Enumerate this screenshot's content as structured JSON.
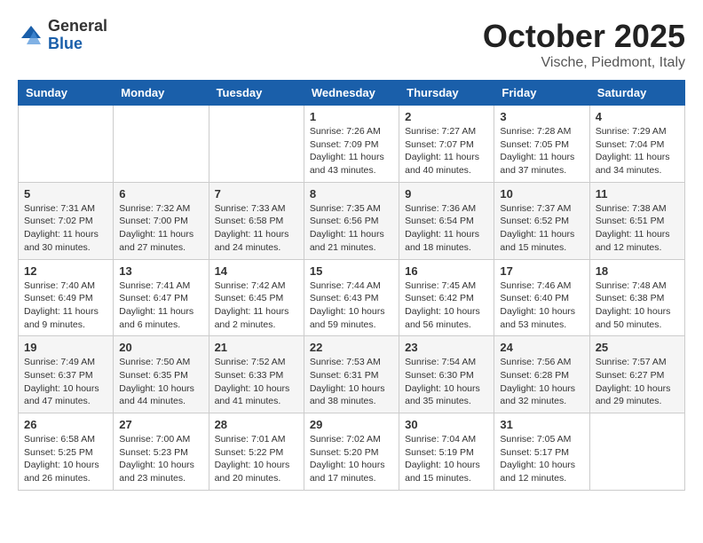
{
  "logo": {
    "general": "General",
    "blue": "Blue"
  },
  "title": "October 2025",
  "location": "Vische, Piedmont, Italy",
  "days_of_week": [
    "Sunday",
    "Monday",
    "Tuesday",
    "Wednesday",
    "Thursday",
    "Friday",
    "Saturday"
  ],
  "weeks": [
    [
      {
        "day": "",
        "info": ""
      },
      {
        "day": "",
        "info": ""
      },
      {
        "day": "",
        "info": ""
      },
      {
        "day": "1",
        "info": "Sunrise: 7:26 AM\nSunset: 7:09 PM\nDaylight: 11 hours\nand 43 minutes."
      },
      {
        "day": "2",
        "info": "Sunrise: 7:27 AM\nSunset: 7:07 PM\nDaylight: 11 hours\nand 40 minutes."
      },
      {
        "day": "3",
        "info": "Sunrise: 7:28 AM\nSunset: 7:05 PM\nDaylight: 11 hours\nand 37 minutes."
      },
      {
        "day": "4",
        "info": "Sunrise: 7:29 AM\nSunset: 7:04 PM\nDaylight: 11 hours\nand 34 minutes."
      }
    ],
    [
      {
        "day": "5",
        "info": "Sunrise: 7:31 AM\nSunset: 7:02 PM\nDaylight: 11 hours\nand 30 minutes."
      },
      {
        "day": "6",
        "info": "Sunrise: 7:32 AM\nSunset: 7:00 PM\nDaylight: 11 hours\nand 27 minutes."
      },
      {
        "day": "7",
        "info": "Sunrise: 7:33 AM\nSunset: 6:58 PM\nDaylight: 11 hours\nand 24 minutes."
      },
      {
        "day": "8",
        "info": "Sunrise: 7:35 AM\nSunset: 6:56 PM\nDaylight: 11 hours\nand 21 minutes."
      },
      {
        "day": "9",
        "info": "Sunrise: 7:36 AM\nSunset: 6:54 PM\nDaylight: 11 hours\nand 18 minutes."
      },
      {
        "day": "10",
        "info": "Sunrise: 7:37 AM\nSunset: 6:52 PM\nDaylight: 11 hours\nand 15 minutes."
      },
      {
        "day": "11",
        "info": "Sunrise: 7:38 AM\nSunset: 6:51 PM\nDaylight: 11 hours\nand 12 minutes."
      }
    ],
    [
      {
        "day": "12",
        "info": "Sunrise: 7:40 AM\nSunset: 6:49 PM\nDaylight: 11 hours\nand 9 minutes."
      },
      {
        "day": "13",
        "info": "Sunrise: 7:41 AM\nSunset: 6:47 PM\nDaylight: 11 hours\nand 6 minutes."
      },
      {
        "day": "14",
        "info": "Sunrise: 7:42 AM\nSunset: 6:45 PM\nDaylight: 11 hours\nand 2 minutes."
      },
      {
        "day": "15",
        "info": "Sunrise: 7:44 AM\nSunset: 6:43 PM\nDaylight: 10 hours\nand 59 minutes."
      },
      {
        "day": "16",
        "info": "Sunrise: 7:45 AM\nSunset: 6:42 PM\nDaylight: 10 hours\nand 56 minutes."
      },
      {
        "day": "17",
        "info": "Sunrise: 7:46 AM\nSunset: 6:40 PM\nDaylight: 10 hours\nand 53 minutes."
      },
      {
        "day": "18",
        "info": "Sunrise: 7:48 AM\nSunset: 6:38 PM\nDaylight: 10 hours\nand 50 minutes."
      }
    ],
    [
      {
        "day": "19",
        "info": "Sunrise: 7:49 AM\nSunset: 6:37 PM\nDaylight: 10 hours\nand 47 minutes."
      },
      {
        "day": "20",
        "info": "Sunrise: 7:50 AM\nSunset: 6:35 PM\nDaylight: 10 hours\nand 44 minutes."
      },
      {
        "day": "21",
        "info": "Sunrise: 7:52 AM\nSunset: 6:33 PM\nDaylight: 10 hours\nand 41 minutes."
      },
      {
        "day": "22",
        "info": "Sunrise: 7:53 AM\nSunset: 6:31 PM\nDaylight: 10 hours\nand 38 minutes."
      },
      {
        "day": "23",
        "info": "Sunrise: 7:54 AM\nSunset: 6:30 PM\nDaylight: 10 hours\nand 35 minutes."
      },
      {
        "day": "24",
        "info": "Sunrise: 7:56 AM\nSunset: 6:28 PM\nDaylight: 10 hours\nand 32 minutes."
      },
      {
        "day": "25",
        "info": "Sunrise: 7:57 AM\nSunset: 6:27 PM\nDaylight: 10 hours\nand 29 minutes."
      }
    ],
    [
      {
        "day": "26",
        "info": "Sunrise: 6:58 AM\nSunset: 5:25 PM\nDaylight: 10 hours\nand 26 minutes."
      },
      {
        "day": "27",
        "info": "Sunrise: 7:00 AM\nSunset: 5:23 PM\nDaylight: 10 hours\nand 23 minutes."
      },
      {
        "day": "28",
        "info": "Sunrise: 7:01 AM\nSunset: 5:22 PM\nDaylight: 10 hours\nand 20 minutes."
      },
      {
        "day": "29",
        "info": "Sunrise: 7:02 AM\nSunset: 5:20 PM\nDaylight: 10 hours\nand 17 minutes."
      },
      {
        "day": "30",
        "info": "Sunrise: 7:04 AM\nSunset: 5:19 PM\nDaylight: 10 hours\nand 15 minutes."
      },
      {
        "day": "31",
        "info": "Sunrise: 7:05 AM\nSunset: 5:17 PM\nDaylight: 10 hours\nand 12 minutes."
      },
      {
        "day": "",
        "info": ""
      }
    ]
  ]
}
